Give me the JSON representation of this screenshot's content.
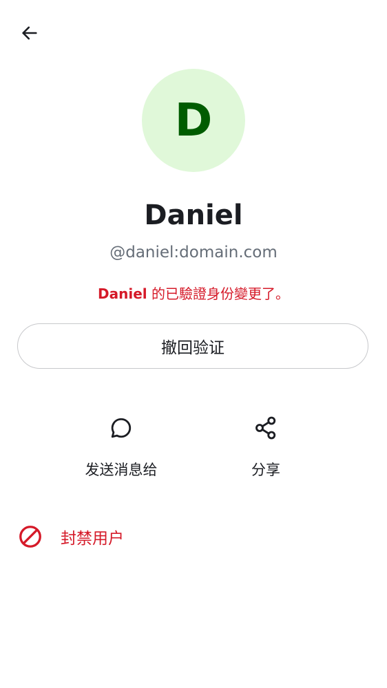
{
  "header": {
    "back_icon": "arrow-left-icon"
  },
  "profile": {
    "avatar_letter": "D",
    "avatar_bg": "#e0f8d9",
    "avatar_fg": "#005c00",
    "display_name": "Daniel",
    "user_id": "@daniel:domain.com"
  },
  "warning": {
    "name": "Daniel",
    "message": " 的已驗證身份變更了。",
    "color": "#d51928"
  },
  "revoke_button": {
    "label": "撤回验证"
  },
  "actions": [
    {
      "label": "发送消息给",
      "icon": "chat-bubble-icon"
    },
    {
      "label": "分享",
      "icon": "share-icon"
    }
  ],
  "ban": {
    "label": "封禁用户",
    "icon": "block-icon",
    "color": "#d51928"
  }
}
